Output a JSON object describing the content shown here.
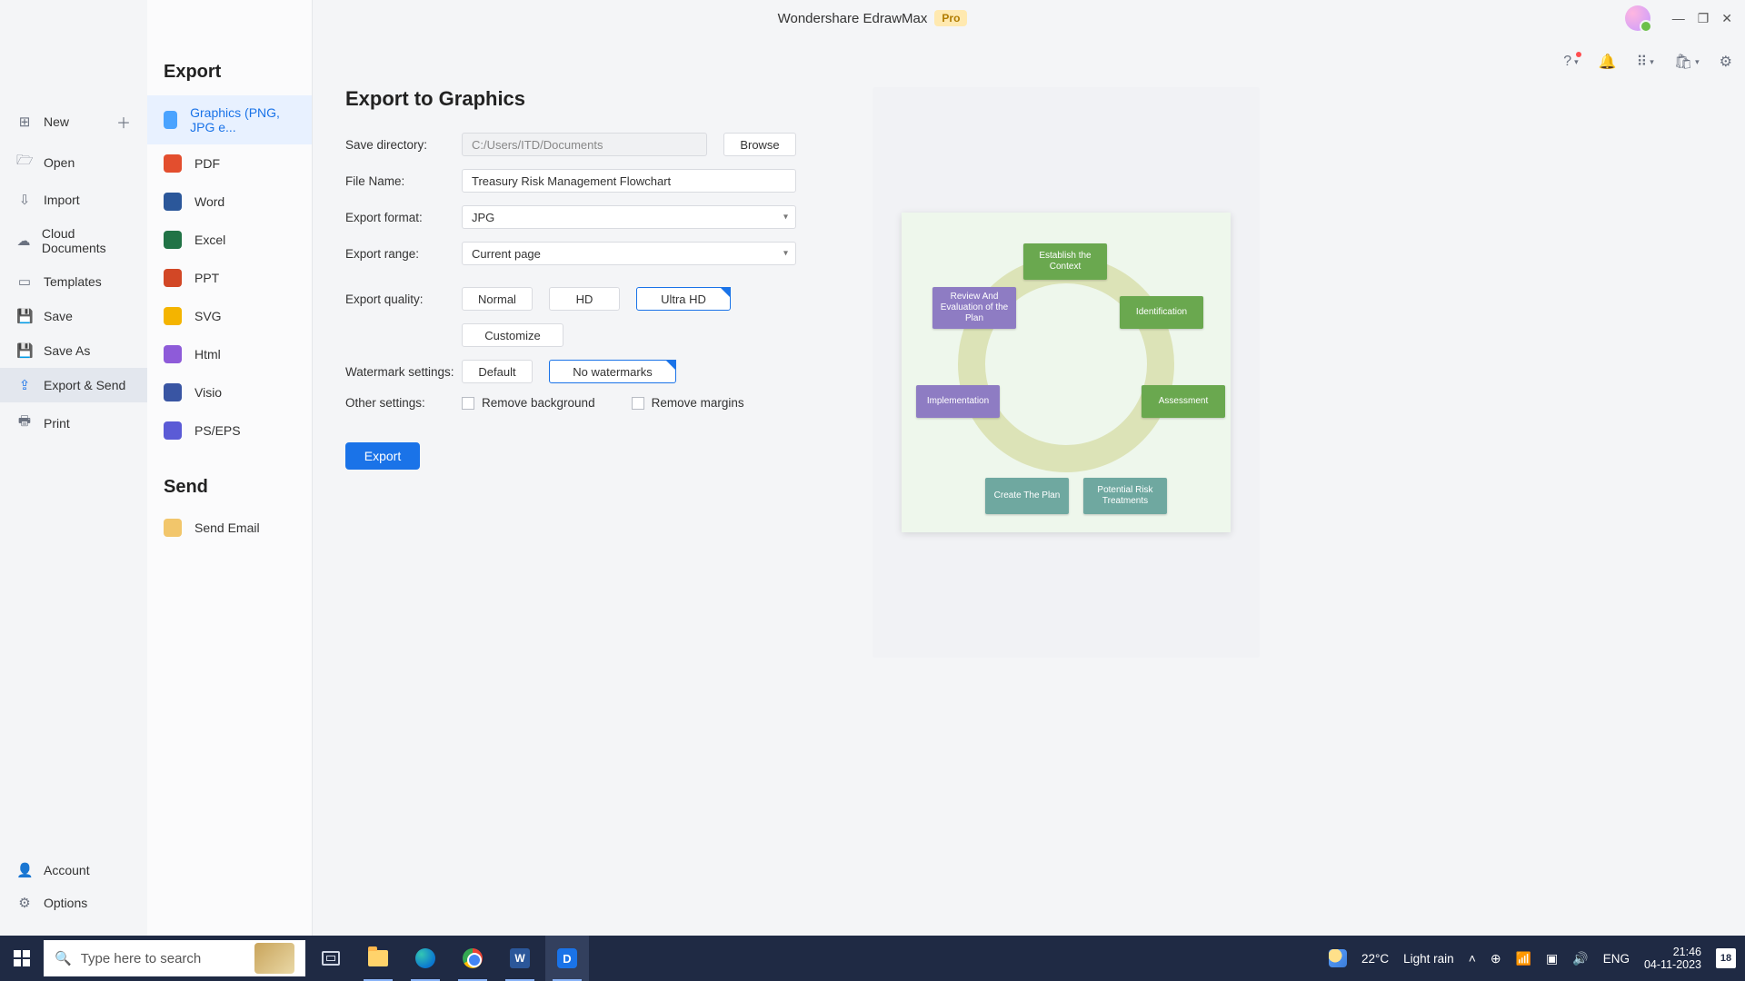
{
  "titlebar": {
    "app": "Wondershare EdrawMax",
    "badge": "Pro"
  },
  "win": {
    "min": "—",
    "max": "❐",
    "close": "✕"
  },
  "iconrow": {
    "help": "?",
    "bell": "🔔",
    "grid": "⠿",
    "cart": "🛍",
    "gear": "⚙"
  },
  "filemenu": {
    "new": "New",
    "open": "Open",
    "import": "Import",
    "cloud": "Cloud Documents",
    "templates": "Templates",
    "save": "Save",
    "saveas": "Save As",
    "export": "Export & Send",
    "print": "Print",
    "account": "Account",
    "options": "Options"
  },
  "fmtcol": {
    "export_h": "Export",
    "graphics": "Graphics (PNG, JPG e...",
    "pdf": "PDF",
    "word": "Word",
    "excel": "Excel",
    "ppt": "PPT",
    "svg": "SVG",
    "html": "Html",
    "visio": "Visio",
    "ps": "PS/EPS",
    "send_h": "Send",
    "email": "Send Email"
  },
  "main": {
    "heading": "Export to Graphics",
    "savedir_l": "Save directory:",
    "savedir_v": "C:/Users/ITD/Documents",
    "browse": "Browse",
    "filename_l": "File Name:",
    "filename_v": "Treasury Risk Management Flowchart",
    "format_l": "Export format:",
    "format_v": "JPG",
    "range_l": "Export range:",
    "range_v": "Current page",
    "quality_l": "Export quality:",
    "q_normal": "Normal",
    "q_hd": "HD",
    "q_uhd": "Ultra HD",
    "customize": "Customize",
    "wm_l": "Watermark settings:",
    "wm_default": "Default",
    "wm_none": "No watermarks",
    "other_l": "Other settings:",
    "remove_bg": "Remove background",
    "remove_margins": "Remove margins",
    "export_btn": "Export"
  },
  "preview": {
    "n1": "Establish the Context",
    "n2": "Identification",
    "n3": "Assessment",
    "n4": "Potential Risk Treatments",
    "n5": "Create The Plan",
    "n6": "Implementation",
    "n7": "Review And Evaluation of the Plan"
  },
  "taskbar": {
    "search_ph": "Type here to search",
    "weather_temp": "22°C",
    "weather_txt": "Light rain",
    "lang": "ENG",
    "time": "21:46",
    "date": "04-11-2023",
    "notif_count": "18",
    "word_letter": "W",
    "edraw_letter": "D"
  }
}
